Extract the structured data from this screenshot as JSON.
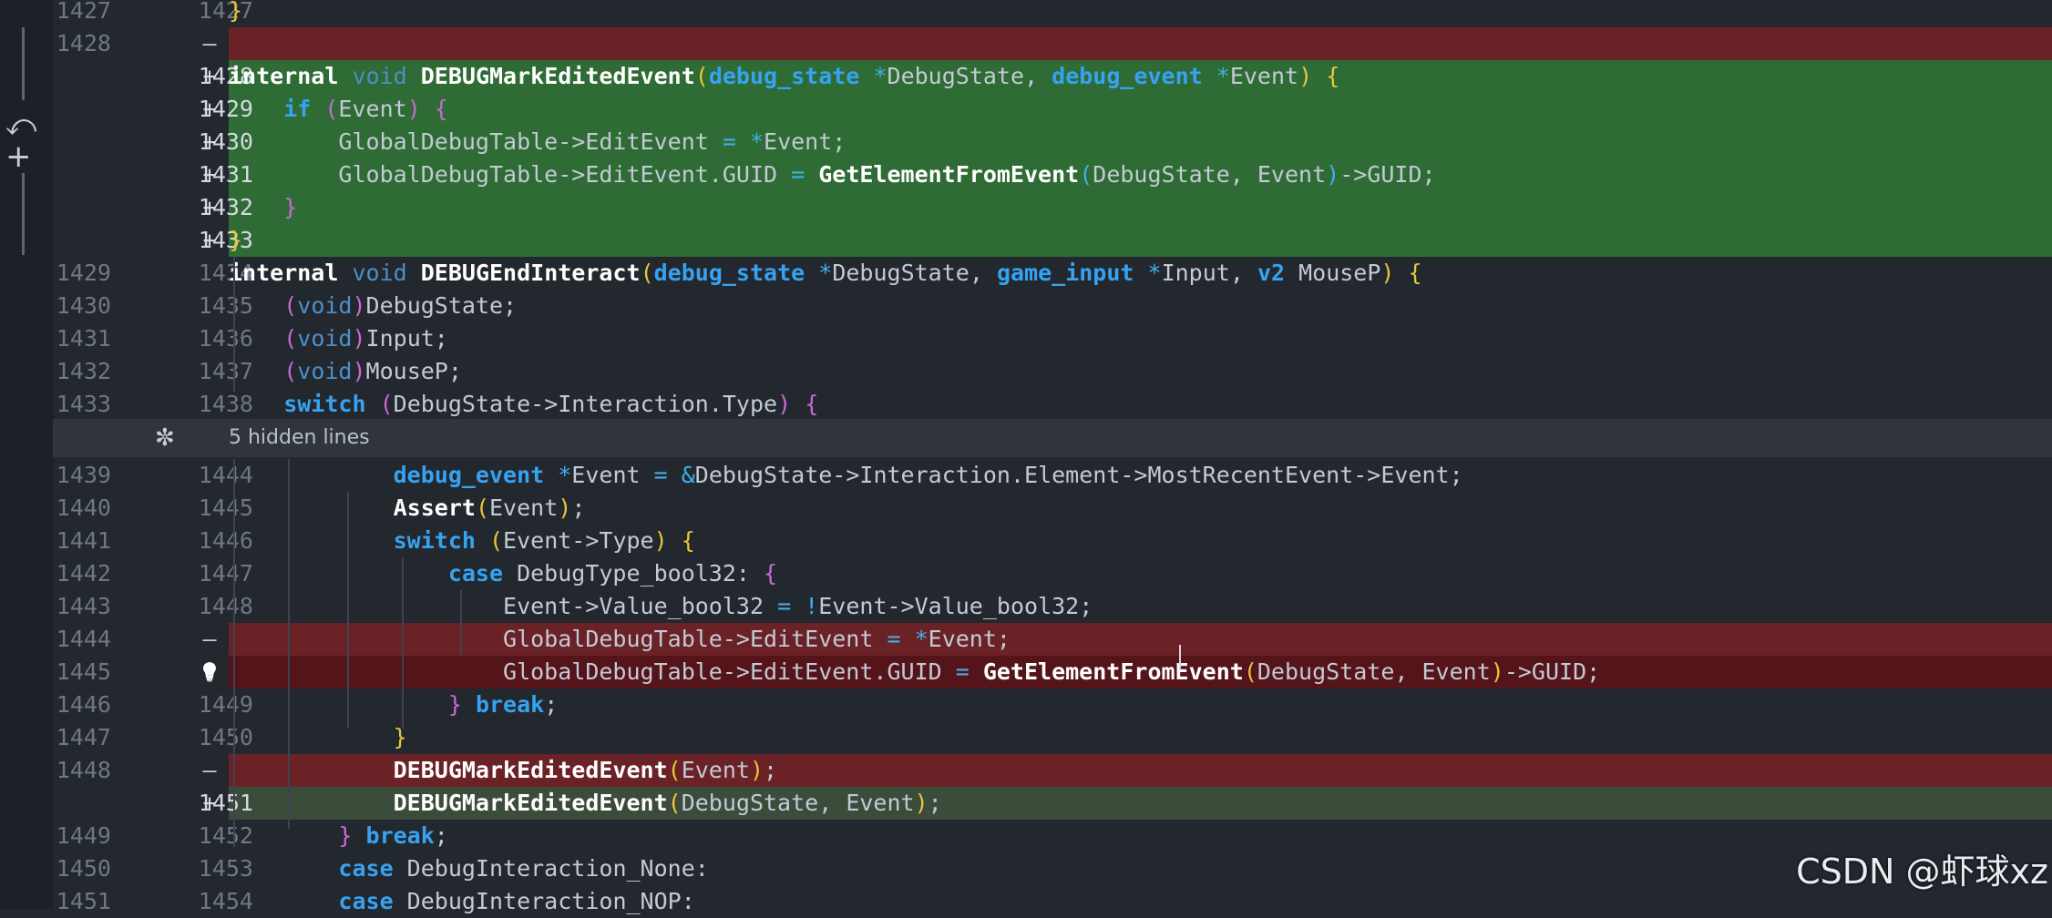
{
  "hidden_lines_label": "5 hidden lines",
  "watermark": "CSDN @虾球xz",
  "colors": {
    "added": "#2f6b34",
    "deleted": "#6a2226",
    "background": "#23272e"
  },
  "icons": [
    "undo-icon",
    "plus-icon",
    "unfold-icon",
    "lightbulb-icon"
  ],
  "lines": [
    {
      "old": "1427",
      "new": "1427",
      "mark": "",
      "segs": [
        [
          "}",
          "br"
        ]
      ]
    },
    {
      "old": "1428",
      "new": "",
      "mark": "—",
      "segs": []
    },
    {
      "old": "",
      "new": "1428",
      "mark": "+",
      "segs": [
        [
          "internal ",
          "kw"
        ],
        [
          "void ",
          "kw2"
        ],
        [
          "DEBUGMarkEditedEvent",
          "fn"
        ],
        [
          "(",
          "br"
        ],
        [
          "debug_state ",
          "ty"
        ],
        [
          "*",
          "op"
        ],
        [
          "DebugState, ",
          "id"
        ],
        [
          "debug_event ",
          "ty"
        ],
        [
          "*",
          "op"
        ],
        [
          "Event",
          "id"
        ],
        [
          ")",
          "br"
        ],
        [
          " {",
          "br"
        ]
      ]
    },
    {
      "old": "",
      "new": "1429",
      "mark": "+",
      "segs": [
        [
          "    if ",
          "ty"
        ],
        [
          "(",
          "pa"
        ],
        [
          "Event",
          "id"
        ],
        [
          ")",
          "pa"
        ],
        [
          " {",
          "pa"
        ]
      ]
    },
    {
      "old": "",
      "new": "1430",
      "mark": "+",
      "segs": [
        [
          "        GlobalDebugTable->EditEvent ",
          "id"
        ],
        [
          "= ",
          "op"
        ],
        [
          "*",
          "op"
        ],
        [
          "Event;",
          "id"
        ]
      ]
    },
    {
      "old": "",
      "new": "1431",
      "mark": "+",
      "segs": [
        [
          "        GlobalDebugTable->EditEvent.GUID ",
          "id"
        ],
        [
          "= ",
          "op"
        ],
        [
          "GetElementFromEvent",
          "fn"
        ],
        [
          "(",
          "op"
        ],
        [
          "DebugState, Event",
          "id"
        ],
        [
          ")",
          "op"
        ],
        [
          "->GUID;",
          "id"
        ]
      ]
    },
    {
      "old": "",
      "new": "1432",
      "mark": "+",
      "segs": [
        [
          "    }",
          "pa"
        ]
      ]
    },
    {
      "old": "",
      "new": "1433",
      "mark": "+",
      "segs": [
        [
          "}",
          "br"
        ]
      ]
    },
    {
      "old": "1429",
      "new": "1434",
      "mark": "",
      "segs": [
        [
          "internal ",
          "kw"
        ],
        [
          "void ",
          "kw2"
        ],
        [
          "DEBUGEndInteract",
          "fn"
        ],
        [
          "(",
          "br"
        ],
        [
          "debug_state ",
          "ty"
        ],
        [
          "*",
          "op"
        ],
        [
          "DebugState, ",
          "id"
        ],
        [
          "game_input ",
          "ty"
        ],
        [
          "*",
          "op"
        ],
        [
          "Input, ",
          "id"
        ],
        [
          "v2 ",
          "ty"
        ],
        [
          "MouseP",
          "id"
        ],
        [
          ")",
          "br"
        ],
        [
          " {",
          "br"
        ]
      ]
    },
    {
      "old": "1430",
      "new": "1435",
      "mark": "",
      "segs": [
        [
          "    (",
          "pa"
        ],
        [
          "void",
          "kw2"
        ],
        [
          ")",
          "pa"
        ],
        [
          "DebugState;",
          "id"
        ]
      ]
    },
    {
      "old": "1431",
      "new": "1436",
      "mark": "",
      "segs": [
        [
          "    (",
          "pa"
        ],
        [
          "void",
          "kw2"
        ],
        [
          ")",
          "pa"
        ],
        [
          "Input;",
          "id"
        ]
      ]
    },
    {
      "old": "1432",
      "new": "1437",
      "mark": "",
      "segs": [
        [
          "    (",
          "pa"
        ],
        [
          "void",
          "kw2"
        ],
        [
          ")",
          "pa"
        ],
        [
          "MouseP;",
          "id"
        ]
      ]
    },
    {
      "old": "1433",
      "new": "1438",
      "mark": "",
      "segs": [
        [
          "    switch ",
          "ty"
        ],
        [
          "(",
          "pa"
        ],
        [
          "DebugState->Interaction.Type",
          "id"
        ],
        [
          ")",
          "pa"
        ],
        [
          " {",
          "pa"
        ]
      ]
    },
    {
      "old": "1439",
      "new": "1444",
      "mark": "",
      "segs": [
        [
          "            debug_event ",
          "ty"
        ],
        [
          "*",
          "op"
        ],
        [
          "Event ",
          "id"
        ],
        [
          "= ",
          "op"
        ],
        [
          "&",
          "op"
        ],
        [
          "DebugState->Interaction.Element->MostRecentEvent->Event;",
          "id"
        ]
      ]
    },
    {
      "old": "1440",
      "new": "1445",
      "mark": "",
      "segs": [
        [
          "            Assert",
          "fn"
        ],
        [
          "(",
          "br"
        ],
        [
          "Event",
          "id"
        ],
        [
          ")",
          "br"
        ],
        [
          ";",
          "id"
        ]
      ]
    },
    {
      "old": "1441",
      "new": "1446",
      "mark": "",
      "segs": [
        [
          "            switch ",
          "ty"
        ],
        [
          "(",
          "br"
        ],
        [
          "Event->Type",
          "id"
        ],
        [
          ")",
          "br"
        ],
        [
          " {",
          "br"
        ]
      ]
    },
    {
      "old": "1442",
      "new": "1447",
      "mark": "",
      "segs": [
        [
          "                case ",
          "ty"
        ],
        [
          "DebugType_bool32: ",
          "id"
        ],
        [
          "{",
          "pa"
        ]
      ]
    },
    {
      "old": "1443",
      "new": "1448",
      "mark": "",
      "segs": [
        [
          "                    Event->Value_bool32 ",
          "id"
        ],
        [
          "= ",
          "op"
        ],
        [
          "!",
          "op"
        ],
        [
          "Event->Value_bool32;",
          "id"
        ]
      ]
    },
    {
      "old": "1444",
      "new": "",
      "mark": "—",
      "segs": [
        [
          "                    GlobalDebugTable->EditEvent ",
          "id"
        ],
        [
          "= ",
          "op"
        ],
        [
          "*",
          "op"
        ],
        [
          "Event;",
          "id"
        ]
      ]
    },
    {
      "old": "1445",
      "new": "",
      "mark": "💡",
      "segs": [
        [
          "                    GlobalDebugTable->EditEvent.GUID ",
          "id"
        ],
        [
          "= ",
          "op"
        ],
        [
          "GetElementFromEvent",
          "fn"
        ],
        [
          "(",
          "br"
        ],
        [
          "DebugState, Event",
          "id"
        ],
        [
          ")",
          "br"
        ],
        [
          "->GUID;",
          "id"
        ]
      ]
    },
    {
      "old": "1446",
      "new": "1449",
      "mark": "",
      "segs": [
        [
          "                ",
          "id"
        ],
        [
          "} ",
          "pa"
        ],
        [
          "break",
          "ty"
        ],
        [
          ";",
          "id"
        ]
      ]
    },
    {
      "old": "1447",
      "new": "1450",
      "mark": "",
      "segs": [
        [
          "            }",
          "br"
        ]
      ]
    },
    {
      "old": "1448",
      "new": "",
      "mark": "—",
      "segs": [
        [
          "            DEBUGMarkEditedEvent",
          "fn"
        ],
        [
          "(",
          "br"
        ],
        [
          "Event",
          "id"
        ],
        [
          ")",
          "br"
        ],
        [
          ";",
          "id"
        ]
      ]
    },
    {
      "old": "",
      "new": "1451",
      "mark": "+",
      "segs": [
        [
          "            DEBUGMarkEditedEvent",
          "fn"
        ],
        [
          "(",
          "br"
        ],
        [
          "DebugState, ",
          "id"
        ],
        [
          "Event",
          "id"
        ],
        [
          ")",
          "br"
        ],
        [
          ";",
          "id"
        ]
      ]
    },
    {
      "old": "1449",
      "new": "1452",
      "mark": "",
      "segs": [
        [
          "        } ",
          "pa"
        ],
        [
          "break",
          "ty"
        ],
        [
          ";",
          "id"
        ]
      ]
    },
    {
      "old": "1450",
      "new": "1453",
      "mark": "",
      "segs": [
        [
          "        case ",
          "ty"
        ],
        [
          "DebugInteraction_None:",
          "id"
        ]
      ]
    },
    {
      "old": "1451",
      "new": "1454",
      "mark": "",
      "segs": [
        [
          "        case ",
          "ty"
        ],
        [
          "DebugInteraction_NOP:",
          "id"
        ]
      ]
    }
  ]
}
